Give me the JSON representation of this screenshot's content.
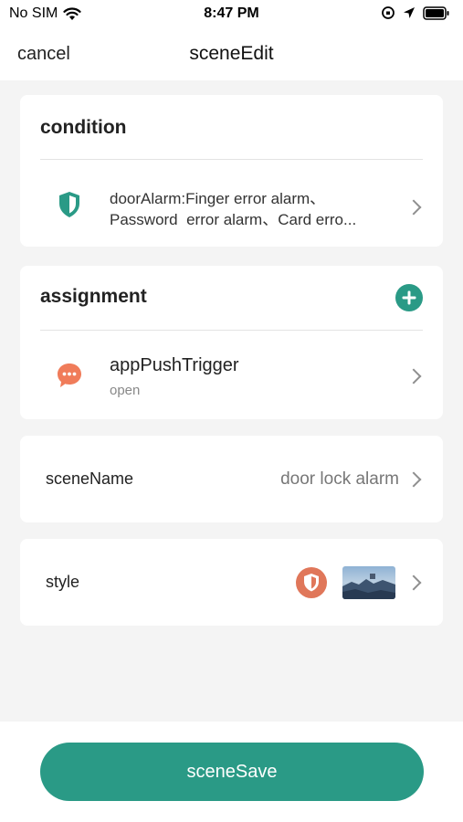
{
  "status_bar": {
    "carrier": "No SIM",
    "time": "8:47 PM"
  },
  "nav": {
    "cancel_label": "cancel",
    "title": "sceneEdit"
  },
  "condition": {
    "title": "condition",
    "item": {
      "icon": "shield-icon",
      "line1": "doorAlarm:Finger error alarm、",
      "line2": "Password  error alarm、Card erro..."
    }
  },
  "assignment": {
    "title": "assignment",
    "add_icon": "plus-circle-icon",
    "item": {
      "icon": "chat-bubble-icon",
      "title": "appPushTrigger",
      "subtitle": "open"
    }
  },
  "scene_name": {
    "label": "sceneName",
    "value": "door lock alarm"
  },
  "style": {
    "label": "style"
  },
  "save_button": {
    "label": "sceneSave"
  },
  "colors": {
    "accent": "#2a9a86",
    "orange": "#f07c5a",
    "style_icon": "#e0775a"
  }
}
